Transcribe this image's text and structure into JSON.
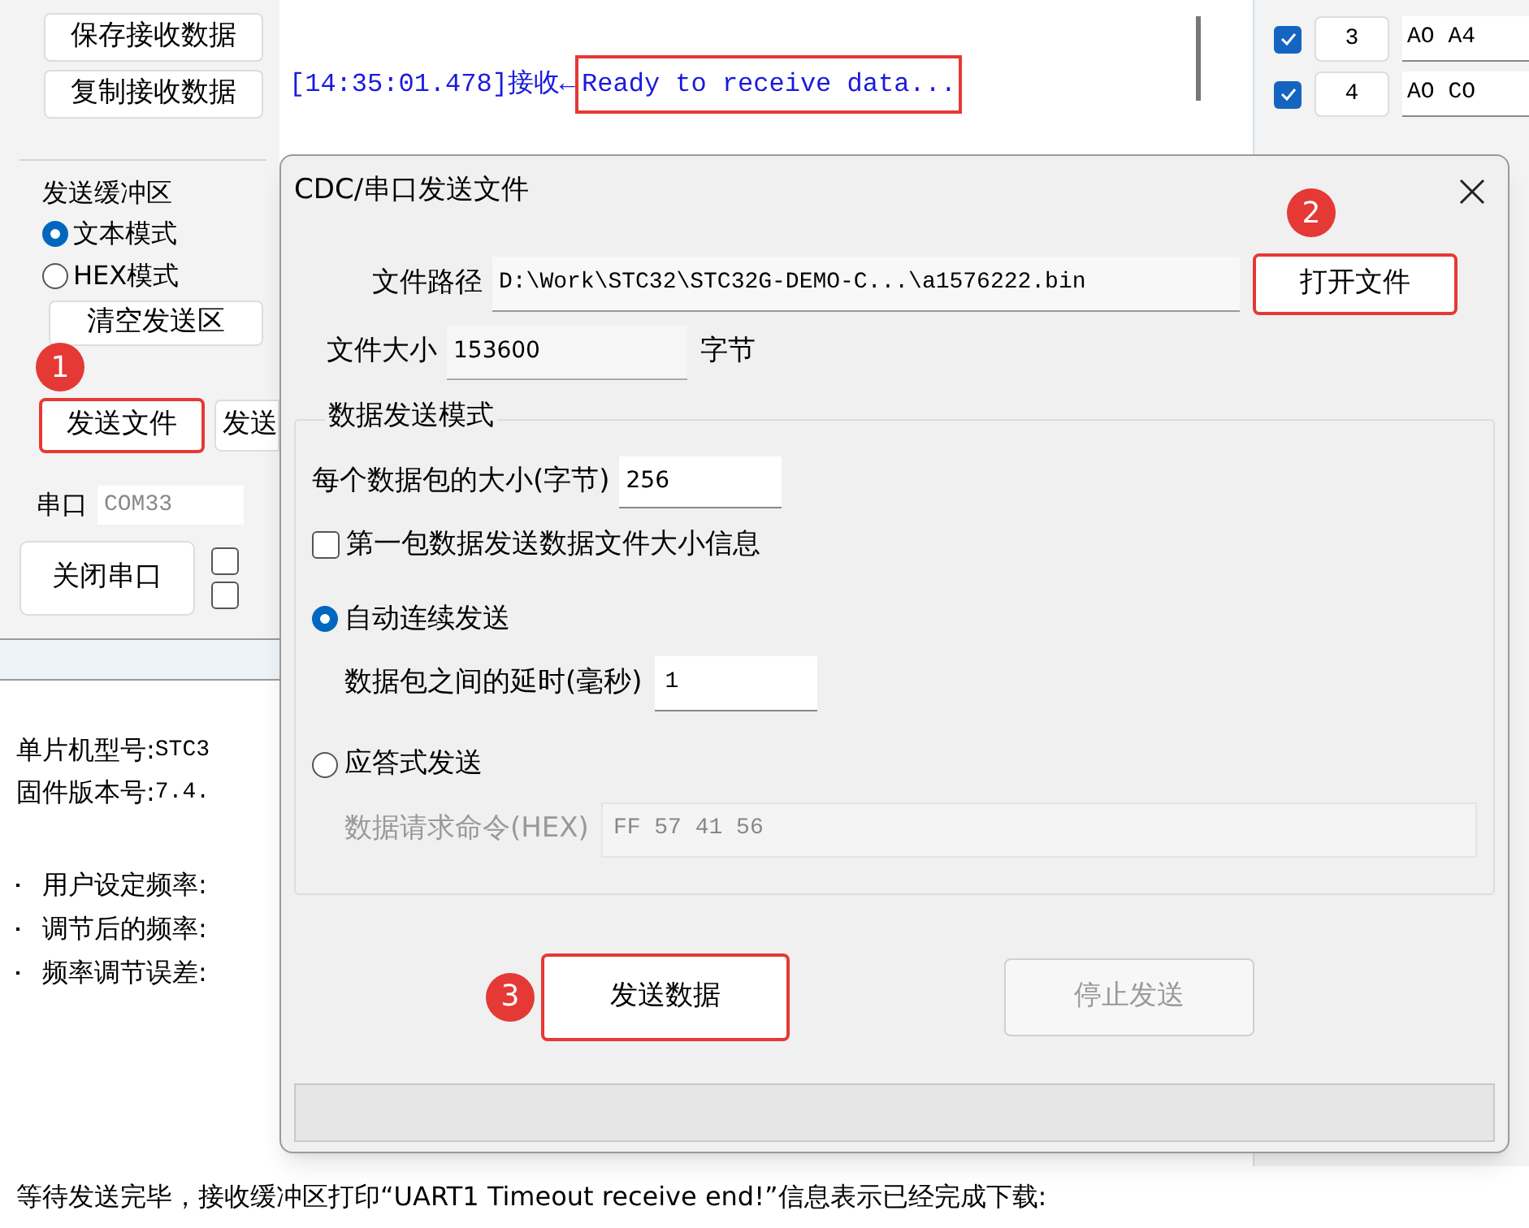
{
  "receive_buttons": [
    "保存接收数据",
    "复制接收数据"
  ],
  "log": {
    "time": "[14:35:01.478]接收←",
    "message": "Ready to receive data...",
    "highlighted": true
  },
  "channels": [
    {
      "checked": true,
      "index": "3",
      "data": "AO A4"
    },
    {
      "checked": true,
      "index": "4",
      "data": "AO CO"
    }
  ],
  "send_buffer": {
    "title": "发送缓冲区",
    "modes": [
      {
        "label": "文本模式",
        "selected": true
      },
      {
        "label": "HEX模式",
        "selected": false
      }
    ],
    "clear_button": "清空发送区"
  },
  "send_file_button": {
    "label": "发送文件",
    "highlighted": true,
    "marker": "1"
  },
  "send_button_2": "发送",
  "port": {
    "label": "串口",
    "value": "COM33"
  },
  "close_port_button": "关闭串口",
  "options": [
    {
      "checked": false
    },
    {
      "checked": false
    }
  ],
  "chip_info": [
    {
      "label": "单片机型号:",
      "value": "STC3"
    },
    {
      "label": "固件版本号:",
      "value": "7.4."
    }
  ],
  "frequency_labels": [
    "用户设定频率:",
    "调节后的频率:",
    "频率调节误差:"
  ],
  "dialog": {
    "title": "CDC/串口发送文件",
    "file_path": {
      "label": "文件路径",
      "value": "D:\\Work\\STC32\\STC32G-DEMO-C...\\a1576222.bin"
    },
    "open_button": {
      "label": "打开文件",
      "highlighted": true,
      "marker": "2"
    },
    "file_size": {
      "label": "文件大小",
      "value": "153600",
      "unit": "字节"
    },
    "group_title": "数据发送模式",
    "packet_size": {
      "label": "每个数据包的大小(字节)",
      "value": "256"
    },
    "first_packet": {
      "label": "第一包数据发送数据文件大小信息",
      "checked": false
    },
    "modes": [
      {
        "label": "自动连续发送",
        "selected": true,
        "field_label": "数据包之间的延时(毫秒)",
        "value": "1",
        "disabled": false
      },
      {
        "label": "应答式发送",
        "selected": false,
        "field_label": "数据请求命令(HEX)",
        "value": "FF 57 41 56",
        "disabled": true
      }
    ],
    "send_button": {
      "label": "发送数据",
      "highlighted": true,
      "marker": "3",
      "disabled": false
    },
    "stop_button": {
      "label": "停止发送",
      "highlighted": false,
      "disabled": true
    },
    "progress": {
      "level": 0
    }
  },
  "caption": "等待发送完毕，接收缓冲区打印“UART1 Timeout receive end!”信息表示已经完成下载:"
}
